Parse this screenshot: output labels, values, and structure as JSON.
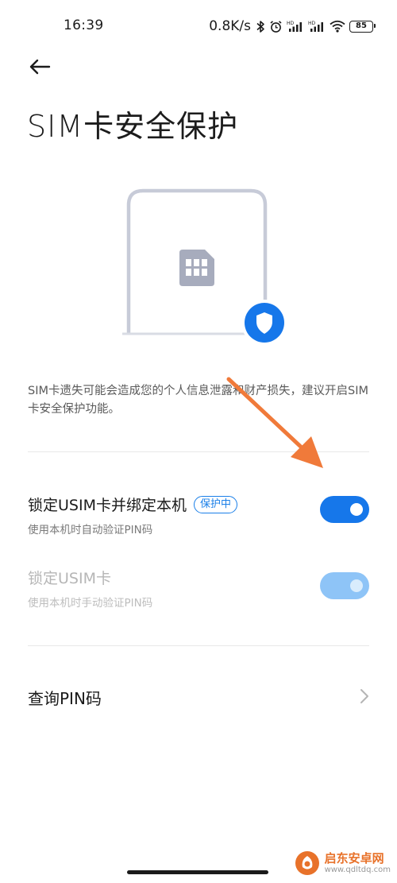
{
  "status_bar": {
    "time": "16:39",
    "net_speed": "0.8K/s",
    "battery": "85",
    "icons": [
      "bluetooth-icon",
      "alarm-icon",
      "signal-hd-icon",
      "signal-hd-icon",
      "wifi-icon",
      "battery-icon"
    ]
  },
  "header": {
    "back_icon": "back-arrow-icon",
    "title": "SIM卡安全保护"
  },
  "illustration": {
    "phone_icon": "phone-outline",
    "sim_icon": "sim-card-icon",
    "shield_icon": "shield-icon",
    "accent_color": "#1677ea"
  },
  "description": "SIM卡遗失可能会造成您的个人信息泄露和财产损失，建议开启SIM卡安全保护功能。",
  "settings": [
    {
      "title": "锁定USIM卡并绑定本机",
      "badge": "保护中",
      "subtitle": "使用本机时自动验证PIN码",
      "enabled": true,
      "toggle_on": true
    },
    {
      "title": "锁定USIM卡",
      "subtitle": "使用本机时手动验证PIN码",
      "enabled": false,
      "toggle_on": true
    }
  ],
  "pin_query": {
    "label": "查询PIN码",
    "chevron_icon": "chevron-right-icon"
  },
  "annotation": {
    "arrow_color": "#f07a3a"
  },
  "watermark": {
    "name": "启东安卓网",
    "url": "www.qdltdq.com",
    "color": "#e8722a"
  }
}
